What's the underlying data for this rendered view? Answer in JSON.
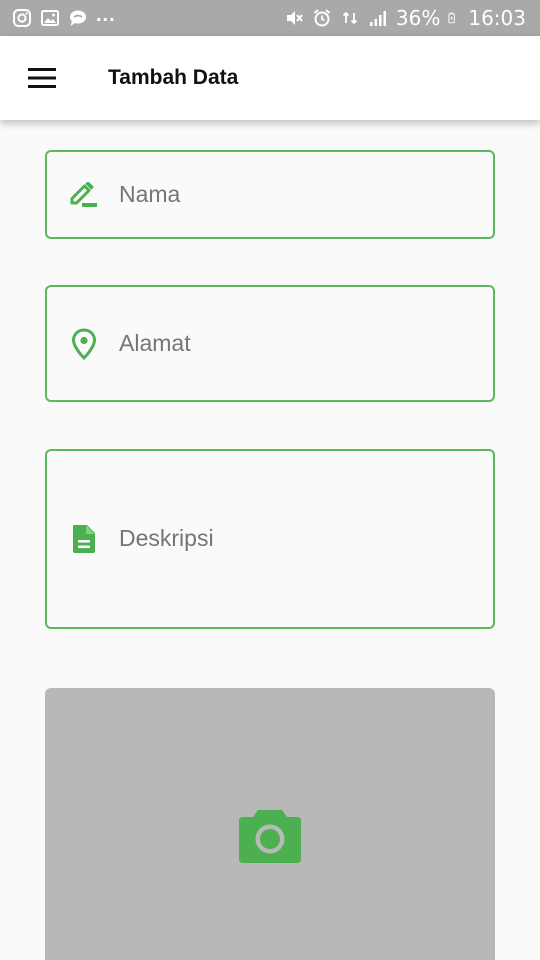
{
  "status_bar": {
    "left_icons": [
      "instagram-icon",
      "gallery-icon",
      "message-icon"
    ],
    "more": "...",
    "right_icons": [
      "mute-icon",
      "alarm-icon",
      "data-icon",
      "signal-icon"
    ],
    "battery": "36%",
    "time": "16:03"
  },
  "app_bar": {
    "menu_icon": "hamburger-menu-icon",
    "title": "Tambah Data"
  },
  "form": {
    "nama": {
      "placeholder": "Nama",
      "value": "",
      "icon": "edit-pencil-icon"
    },
    "alamat": {
      "placeholder": "Alamat",
      "value": "",
      "icon": "location-pin-icon"
    },
    "deskripsi": {
      "placeholder": "Deskripsi",
      "value": "",
      "icon": "document-icon"
    }
  },
  "photo": {
    "icon": "camera-icon"
  },
  "colors": {
    "accent": "#4caf50",
    "field_border": "#5cb85c",
    "status_bar": "#a9a9a9",
    "photo_bg": "#b8b8b8",
    "background": "#fafafa"
  }
}
